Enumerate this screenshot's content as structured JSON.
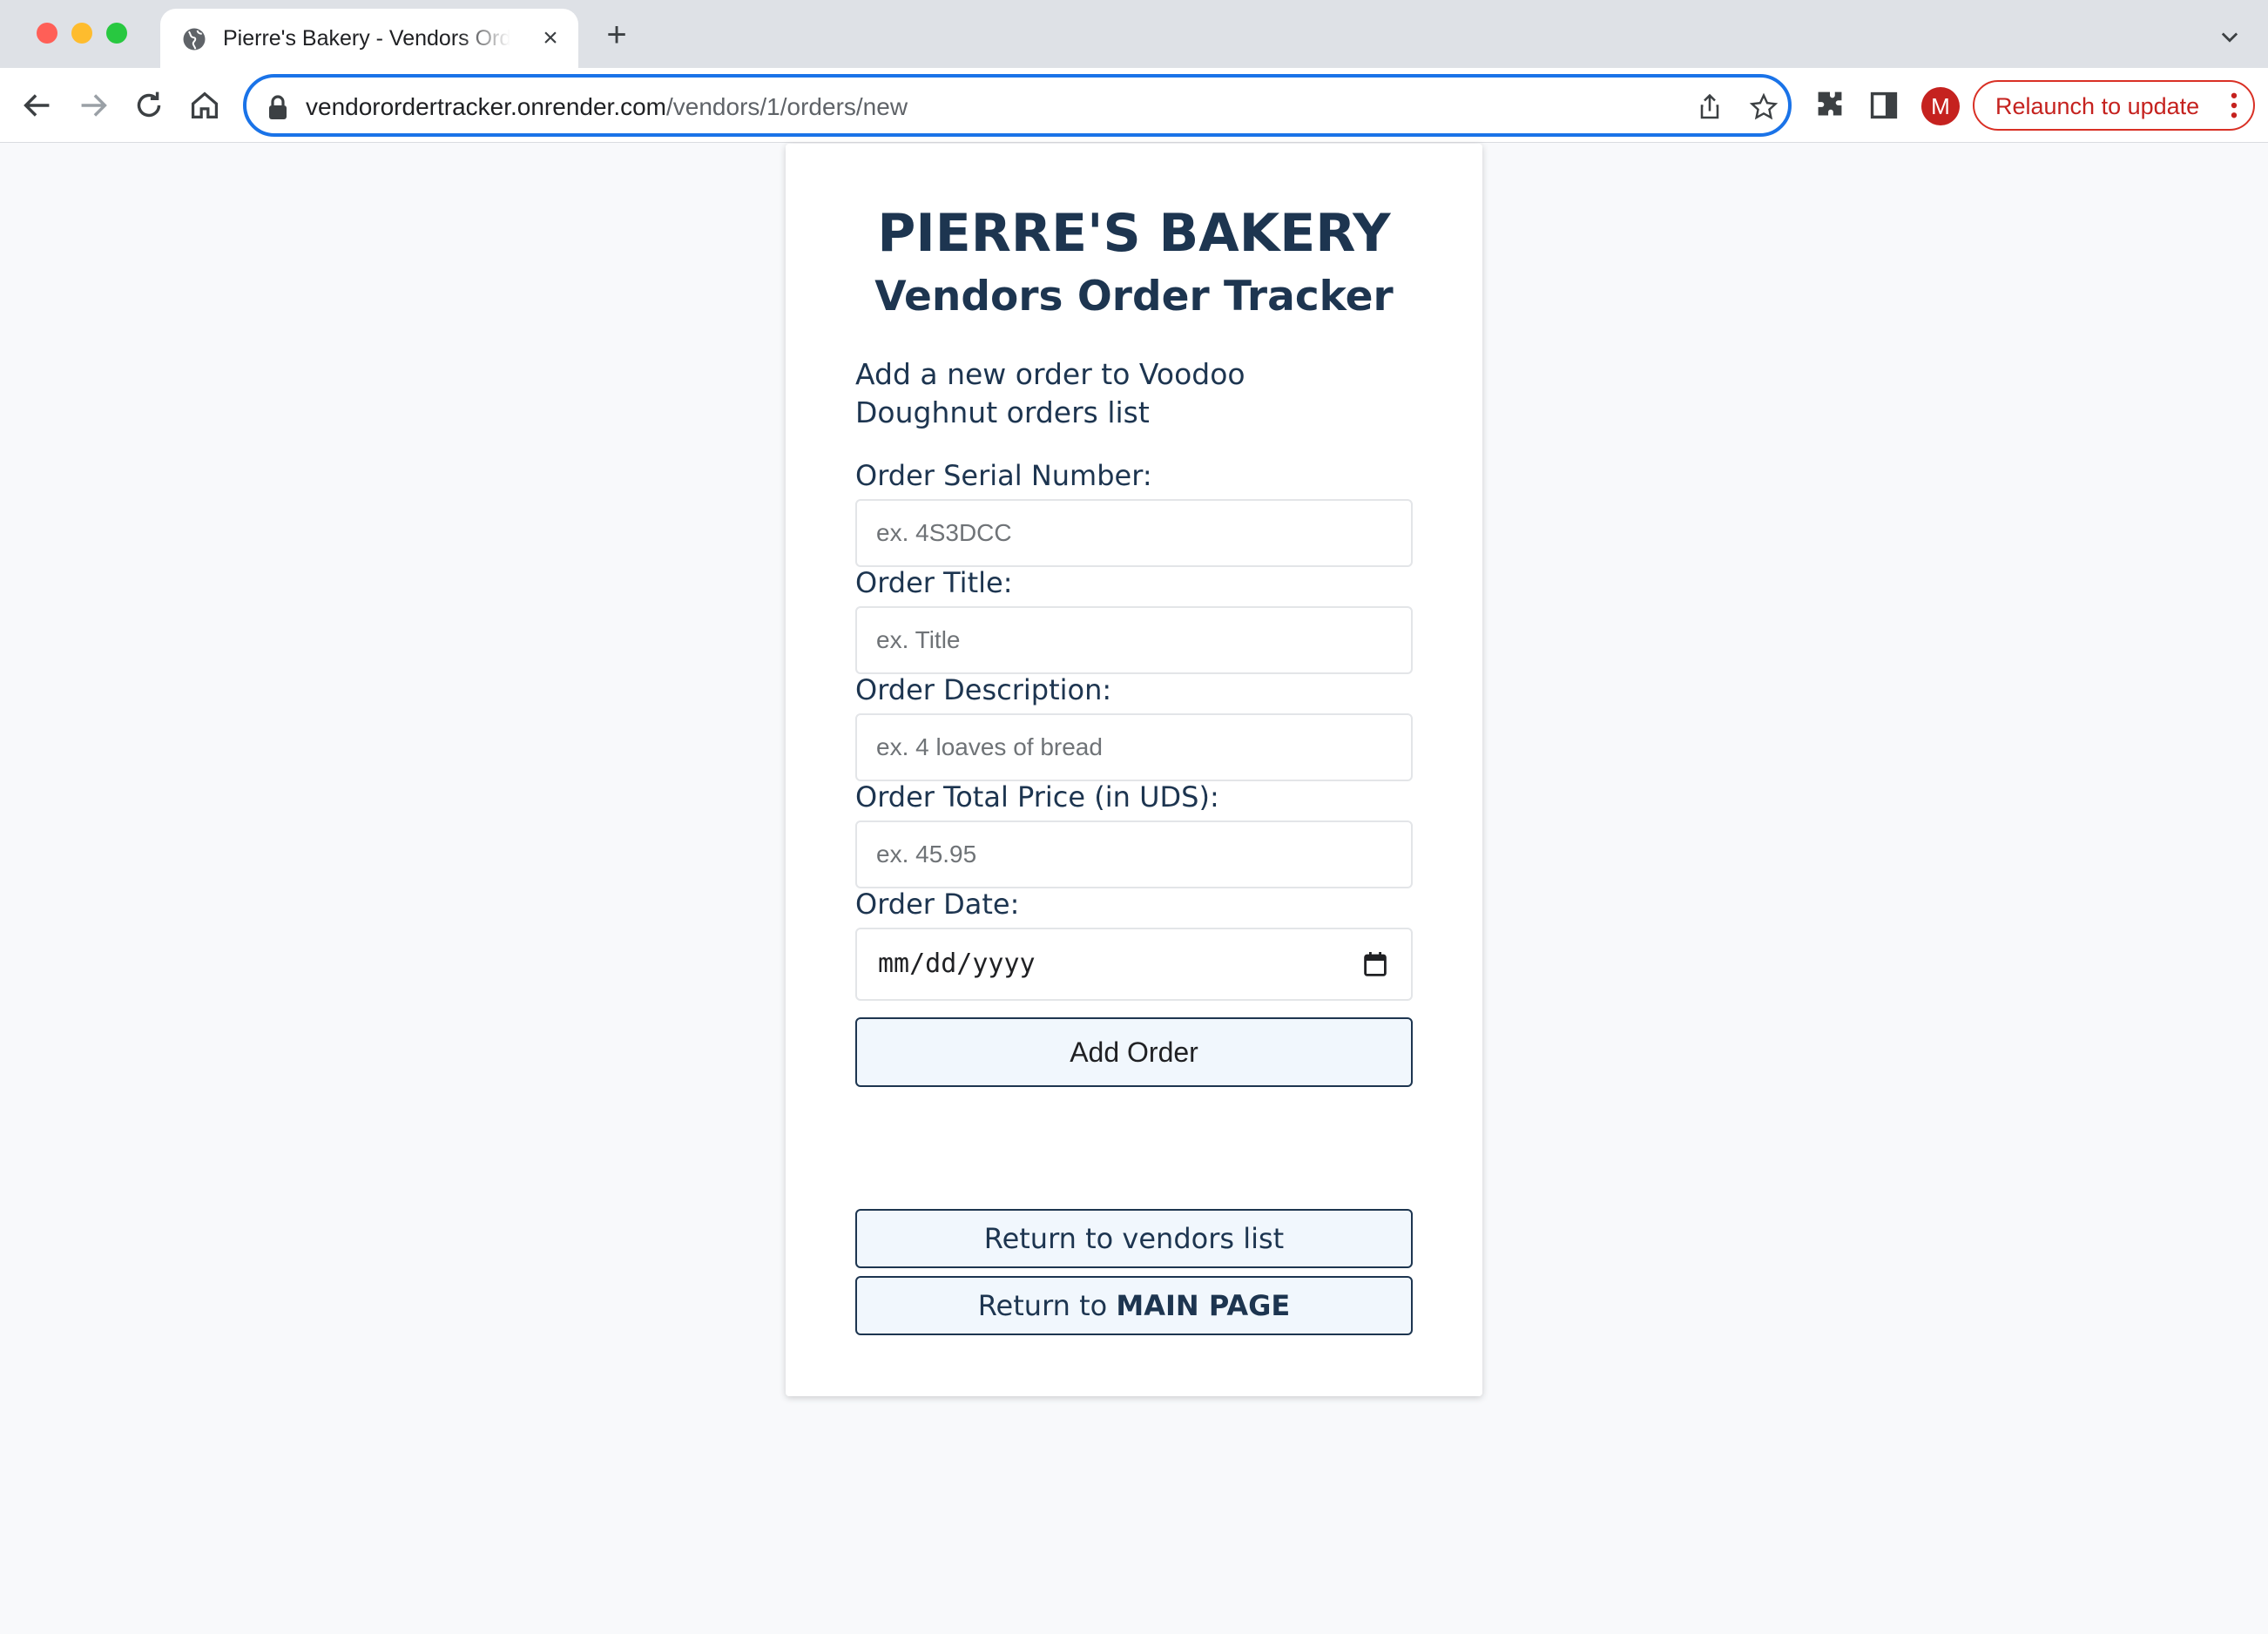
{
  "browser": {
    "tab_title": "Pierre's Bakery - Vendors Order Tracker",
    "close_glyph": "×",
    "new_tab_glyph": "+",
    "url_domain": "vendorordertracker.onrender.com",
    "url_path": "/vendors/1/orders/new",
    "profile_initial": "M",
    "relaunch_label": "Relaunch to update",
    "icons": [
      "globe-icon",
      "back-icon",
      "forward-icon",
      "reload-icon",
      "home-icon",
      "lock-icon",
      "share-icon",
      "star-icon",
      "puzzle-icon",
      "side-panel-icon",
      "kebab-menu-icon",
      "tab-search-icon"
    ],
    "accent_color": "#1a73e8",
    "relaunch_color": "#c5221f"
  },
  "page": {
    "brand": "PIERRE'S BAKERY",
    "subtitle": "Vendors Order Tracker",
    "intro": "Add a new order to Voodoo Doughnut orders list",
    "text_color": "#1d3550",
    "form": {
      "serial_label": "Order Serial Number:",
      "serial_placeholder": "ex. 4S3DCC",
      "title_label": "Order Title:",
      "title_placeholder": "ex. Title",
      "description_label": "Order Description:",
      "description_placeholder": "ex. 4 loaves of bread",
      "price_label": "Order Total Price (in UDS):",
      "price_placeholder": "ex. 45.95",
      "date_label": "Order Date:",
      "date_placeholder": "mm/dd/yyyy",
      "submit_label": "Add Order"
    },
    "links": {
      "vendors_label": "Return to vendors list",
      "main_prefix": "Return to",
      "main_emphasis": "MAIN PAGE"
    }
  }
}
